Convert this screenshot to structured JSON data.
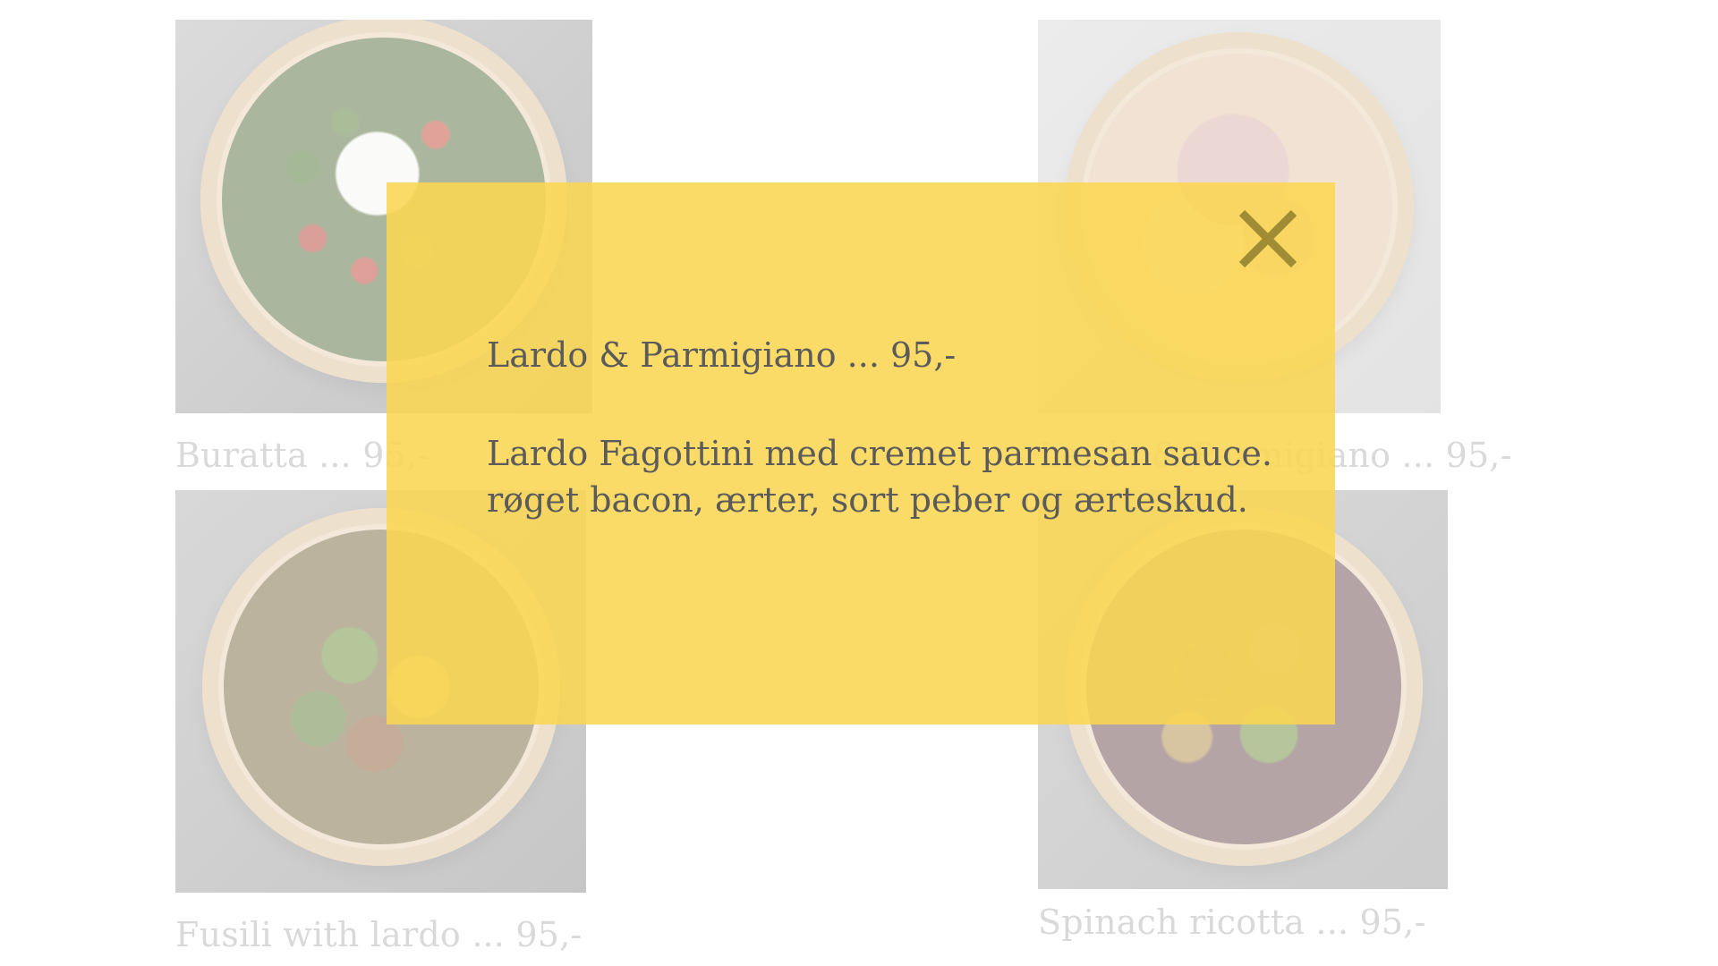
{
  "menu": {
    "items": [
      {
        "caption": "Buratta ... 95,-",
        "photo": "buratta-bowl-photo"
      },
      {
        "caption": "Lardo & Parmigiano ... 95,-",
        "photo": "lardo-bowl-photo"
      },
      {
        "caption": "Fusili with lardo ... 95,-",
        "photo": "fusili-bowl-photo"
      },
      {
        "caption": "Spinach ricotta ... 95,-",
        "photo": "spinach-bowl-photo"
      }
    ]
  },
  "modal": {
    "title": "Lardo & Parmigiano ... 95,-",
    "description_lines": [
      "Lardo Fagottini med cremet parmesan sauce.",
      "røget bacon, ærter, sort peber og ærteskud."
    ],
    "close_icon": "close-icon",
    "background_color": "#FAD652",
    "text_color": "#5B5B5B"
  }
}
